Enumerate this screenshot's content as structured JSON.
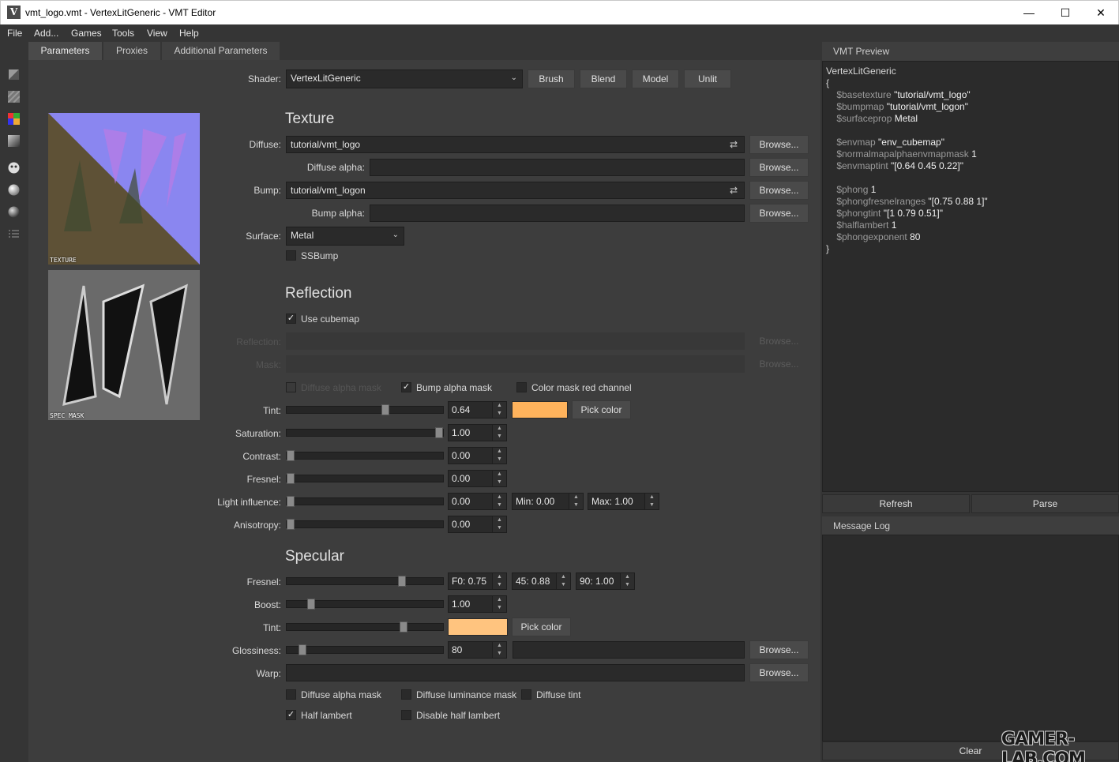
{
  "window": {
    "title": "vmt_logo.vmt - VertexLitGeneric - VMT Editor",
    "minimize": "—",
    "maximize": "☐",
    "close": "✕"
  },
  "menu": [
    "File",
    "Add...",
    "Games",
    "Tools",
    "View",
    "Help"
  ],
  "tabs": [
    "Parameters",
    "Proxies",
    "Additional Parameters"
  ],
  "shader": {
    "label": "Shader:",
    "value": "VertexLitGeneric",
    "buttons": [
      "Brush",
      "Blend",
      "Model",
      "Unlit"
    ]
  },
  "thumbs": {
    "texture": "TEXTURE",
    "spec": "SPEC MASK"
  },
  "texture": {
    "title": "Texture",
    "diffuse_label": "Diffuse:",
    "diffuse": "tutorial/vmt_logo",
    "diffuse_alpha_label": "Diffuse alpha:",
    "bump_label": "Bump:",
    "bump": "tutorial/vmt_logon",
    "bump_alpha_label": "Bump alpha:",
    "surface_label": "Surface:",
    "surface": "Metal",
    "ssbump": "SSBump",
    "browse": "Browse..."
  },
  "reflection": {
    "title": "Reflection",
    "use_cubemap": "Use cubemap",
    "reflection_label": "Reflection:",
    "mask_label": "Mask:",
    "diffuse_alpha_mask": "Diffuse alpha mask",
    "bump_alpha_mask": "Bump alpha mask",
    "color_mask_red": "Color mask red channel",
    "tint_label": "Tint:",
    "tint_value": "0.64",
    "pick_color": "Pick color",
    "tint_color": "#ffb35c",
    "saturation_label": "Saturation:",
    "saturation": "1.00",
    "contrast_label": "Contrast:",
    "contrast": "0.00",
    "fresnel_label": "Fresnel:",
    "fresnel": "0.00",
    "light_label": "Light influence:",
    "light": "0.00",
    "light_min": "Min: 0.00",
    "light_max": "Max: 1.00",
    "aniso_label": "Anisotropy:",
    "aniso": "0.00",
    "levels": {
      "tint": 0.64,
      "saturation": 1.0,
      "contrast": 0.0,
      "fresnel": 0.0,
      "light": 0.0,
      "aniso": 0.0
    }
  },
  "specular": {
    "title": "Specular",
    "fresnel_label": "Fresnel:",
    "f0": "F0:  0.75",
    "f45": "45:  0.88",
    "f90": "90:  1.00",
    "boost_label": "Boost:",
    "boost": "1.00",
    "tint_label": "Tint:",
    "tint_color": "#ffc47f",
    "pick_color": "Pick color",
    "gloss_label": "Glossiness:",
    "gloss": "80",
    "warp_label": "Warp:",
    "diffuse_alpha_mask": "Diffuse alpha mask",
    "diffuse_lum_mask": "Diffuse luminance mask",
    "diffuse_tint": "Diffuse tint",
    "half_lambert": "Half lambert",
    "disable_half_lambert": "Disable half lambert",
    "levels": {
      "fresnel": 0.75,
      "boost": 0.14,
      "tint": 0.76,
      "gloss": 0.08
    }
  },
  "preview": {
    "title": "VMT Preview",
    "lines": [
      {
        "t": "VertexLitGeneric"
      },
      {
        "t": "{"
      },
      {
        "k": "    $basetexture ",
        "v": "\"tutorial/vmt_logo\""
      },
      {
        "k": "    $bumpmap ",
        "v": "\"tutorial/vmt_logon\""
      },
      {
        "k": "    $surfaceprop ",
        "v": "Metal"
      },
      {
        "t": ""
      },
      {
        "k": "    $envmap ",
        "v": "\"env_cubemap\""
      },
      {
        "k": "    $normalmapalphaenvmapmask ",
        "v": "1"
      },
      {
        "k": "    $envmaptint ",
        "v": "\"[0.64 0.45 0.22]\""
      },
      {
        "t": ""
      },
      {
        "k": "    $phong ",
        "v": "1"
      },
      {
        "k": "    $phongfresnelranges ",
        "v": "\"[0.75 0.88 1]\""
      },
      {
        "k": "    $phongtint ",
        "v": "\"[1 0.79 0.51]\""
      },
      {
        "k": "    $halflambert ",
        "v": "1"
      },
      {
        "k": "    $phongexponent ",
        "v": "80"
      },
      {
        "t": "}"
      }
    ],
    "refresh": "Refresh",
    "parse": "Parse"
  },
  "log": {
    "title": "Message Log",
    "clear": "Clear"
  },
  "watermark": "GAMER-LAB.COM"
}
